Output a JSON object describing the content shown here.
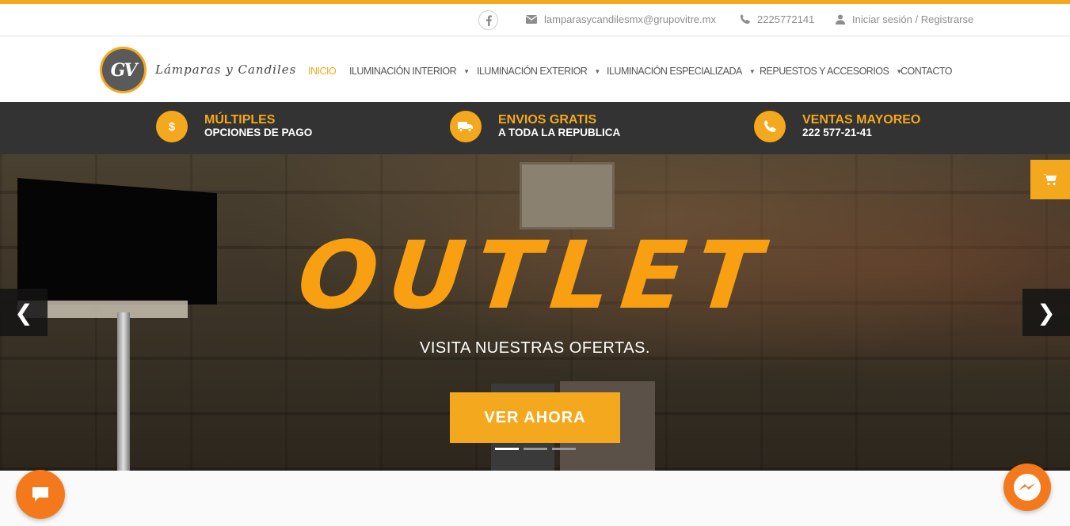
{
  "colors": {
    "accent": "#f4a81d",
    "dark_band": "#333333",
    "chat": "#f4791d"
  },
  "topbar": {
    "facebook_icon": "facebook-icon",
    "email": "lamparasycandilesmx@grupovitre.mx",
    "phone": "2225772141",
    "login": "Iniciar sesión / Registrarse"
  },
  "header": {
    "logo_mark": "GV",
    "logo_text": "Lámparas y Candiles",
    "nav": [
      {
        "label": "INICIO",
        "active": true
      },
      {
        "label": "ILUMINACIÓN INTERIOR",
        "dropdown": true
      },
      {
        "label": "ILUMINACIÓN EXTERIOR",
        "dropdown": true
      },
      {
        "label": "ILUMINACIÓN ESPECIALIZADA",
        "dropdown": true
      },
      {
        "label": "REPUESTOS Y ACCESORIOS",
        "dropdown": true
      },
      {
        "label": "CONTACTO"
      }
    ]
  },
  "features": [
    {
      "icon": "dollar-icon",
      "title": "MÚLTIPLES",
      "subtitle": "OPCIONES DE PAGO"
    },
    {
      "icon": "truck-icon",
      "title": "ENVIOS GRATIS",
      "subtitle": "A TODA LA REPUBLICA"
    },
    {
      "icon": "phone-icon",
      "title": "VENTAS MAYOREO",
      "subtitle": "222 577-21-41"
    }
  ],
  "hero": {
    "title": "OUTLET",
    "subtitle": "VISITA NUESTRAS OFERTAS.",
    "button": "VER AHORA",
    "slides": 3,
    "active_slide": 1
  }
}
